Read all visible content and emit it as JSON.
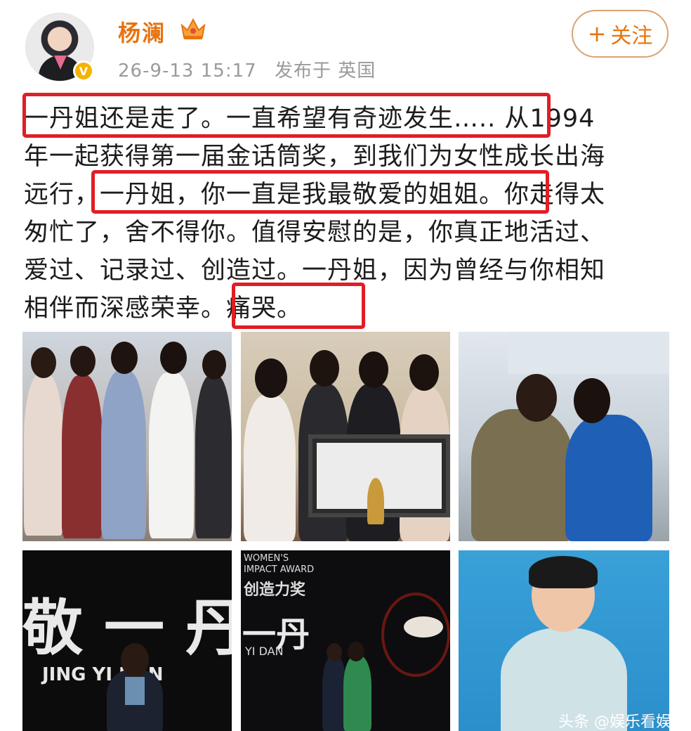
{
  "user": {
    "name": "杨澜",
    "timestamp": "26-9-13 15:17",
    "location": "发布于 英国",
    "follow_label": "关注"
  },
  "post": {
    "lines": [
      "一丹姐还是走了。一直希望有奇迹发生….. 从1994",
      "年一起获得第一届金话筒奖，到我们为女性成长出海",
      "远行，一丹姐，你一直是我最敬爱的姐姐。你走得太",
      "匆忙了，舍不得你。值得安慰的是，你真正地活过、",
      "爱过、记录过、创造过。一丹姐，因为曾经与你相知",
      "相伴而深感荣幸。痛哭。"
    ]
  },
  "photos": {
    "p4": {
      "title": "敬 一 丹",
      "subtitle": "JING  YI  DAN"
    },
    "p5": {
      "award_line1": "WOMEN'S",
      "award_line2": "IMPACT AWARD",
      "award_cn": "创造力奖",
      "title": "一丹",
      "subtitle": "YI DAN"
    },
    "p6": {
      "watermark": "头条 @娱乐看娱"
    }
  },
  "colors": {
    "accent": "#e8730f",
    "highlight": "#e01e25",
    "meta": "#9a9a9a"
  }
}
